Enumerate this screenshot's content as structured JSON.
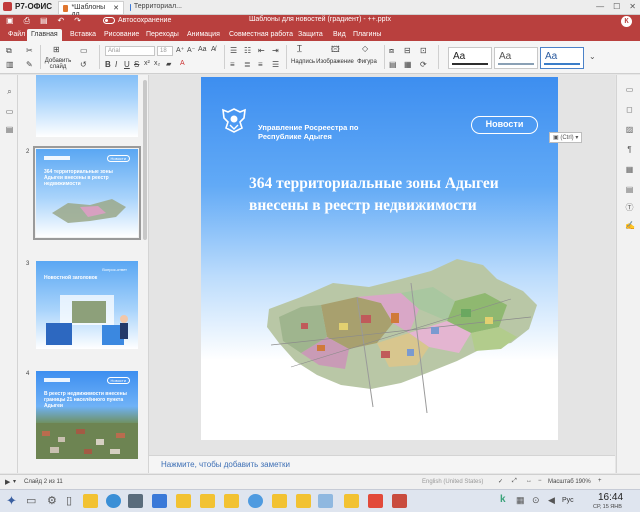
{
  "app": {
    "name": "Р7-ОФИС"
  },
  "tabs": [
    {
      "label": "*Шаблоны дл...",
      "color": "#e0762f"
    },
    {
      "label": "Территориал...",
      "color": "#3a79d8"
    }
  ],
  "titlebar": {
    "title": "Шаблоны для новостей (градиент) - ++.pptx",
    "autosave_label": "Автосохранение",
    "avatar": "К"
  },
  "menu": [
    "Файл",
    "Главная",
    "Вставка",
    "Рисование",
    "Переходы",
    "Анимация",
    "Совместная работа",
    "Защита",
    "Вид",
    "Плагины"
  ],
  "toolbar": {
    "add_slide": "Добавить слайд",
    "font_name": "Arial",
    "font_size": "18",
    "textbox": "Надпись",
    "image": "Изображение",
    "shape": "Фигура",
    "theme_sample": "Aa"
  },
  "slides": [
    {
      "number": "2",
      "title": "364 территориальные зоны Адыгеи внесены в реестр недвижимости",
      "pill": "Новости"
    },
    {
      "number": "3",
      "title": "Новостной заголовок",
      "pill": "Вопрос-ответ"
    },
    {
      "number": "4",
      "title": "В реестр недвижимости внесены границы 21 населённого пункта Адыгеи",
      "pill": "Новости"
    }
  ],
  "slide": {
    "org": "Управление Росреестра по Республике Адыгея",
    "pill": "Новости",
    "headline": "364 территориальные зоны Адыгеи внесены в реестр недвижимости"
  },
  "ctrl_tip": "(Ctrl)",
  "notes": "Нажмите, чтобы добавить заметки",
  "status": {
    "slide_of": "Слайд 2 из 11",
    "language": "English (United States)",
    "zoom": "Масштаб 190%"
  },
  "taskbar": {
    "lang": "Рус",
    "time": "16:44",
    "date": "СР, 15 ЯНВ"
  }
}
